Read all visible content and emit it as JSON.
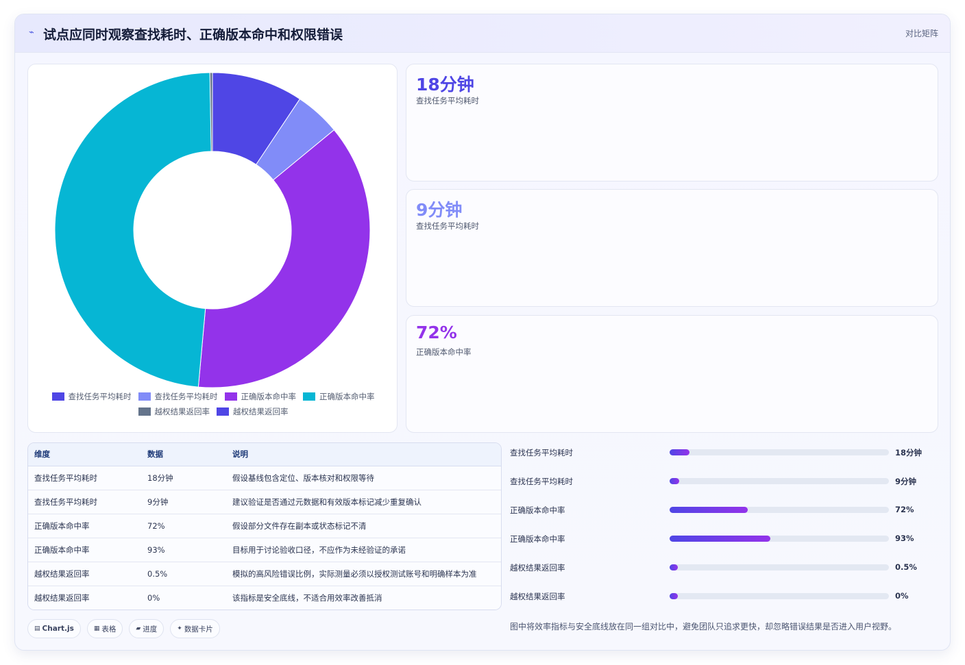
{
  "header": {
    "icon": "trend-icon",
    "title": "试点应同时观察查找耗时、正确版本命中和权限错误",
    "badge": "对比矩阵"
  },
  "colors": {
    "indigo": "#4f46e5",
    "light_indigo": "#818cf8",
    "violet": "#9333ea",
    "cyan": "#06b6d4",
    "slate": "#64748b"
  },
  "chart_data": {
    "type": "doughnut",
    "title": "",
    "legend_position": "bottom",
    "categories": [
      "查找任务平均耗时",
      "查找任务平均耗时",
      "正确版本命中率",
      "正确版本命中率",
      "越权结果返回率",
      "越权结果返回率"
    ],
    "values": [
      18,
      9,
      72,
      93,
      0.5,
      0
    ],
    "colors": [
      "#4f46e5",
      "#818cf8",
      "#9333ea",
      "#06b6d4",
      "#64748b",
      "#4f46e5"
    ]
  },
  "kpis": [
    {
      "value": "18分钟",
      "label": "查找任务平均耗时",
      "color": "#4f46e5"
    },
    {
      "value": "9分钟",
      "label": "查找任务平均耗时",
      "color": "#818cf8"
    },
    {
      "value": "72%",
      "label": "正确版本命中率",
      "color": "#9333ea"
    }
  ],
  "table": {
    "headers": [
      "维度",
      "数据",
      "说明"
    ],
    "rows": [
      [
        "查找任务平均耗时",
        "18分钟",
        "假设基线包含定位、版本核对和权限等待"
      ],
      [
        "查找任务平均耗时",
        "9分钟",
        "建议验证是否通过元数据和有效版本标记减少重复确认"
      ],
      [
        "正确版本命中率",
        "72%",
        "假设部分文件存在副本或状态标记不清"
      ],
      [
        "正确版本命中率",
        "93%",
        "目标用于讨论验收口径，不应作为未经验证的承诺"
      ],
      [
        "越权结果返回率",
        "0.5%",
        "模拟的高风险错误比例，实际测量必须以授权测试账号和明确样本为准"
      ],
      [
        "越权结果返回率",
        "0%",
        "该指标是安全底线，不适合用效率改善抵消"
      ]
    ]
  },
  "progress": [
    {
      "label": "查找任务平均耗时",
      "value": "18分钟",
      "fraction": 0.09
    },
    {
      "label": "查找任务平均耗时",
      "value": "9分钟",
      "fraction": 0.045
    },
    {
      "label": "正确版本命中率",
      "value": "72%",
      "fraction": 0.355
    },
    {
      "label": "正确版本命中率",
      "value": "93%",
      "fraction": 0.458
    },
    {
      "label": "越权结果返回率",
      "value": "0.5%",
      "fraction": 0.036
    },
    {
      "label": "越权结果返回率",
      "value": "0%",
      "fraction": 0.036
    }
  ],
  "chips": [
    {
      "icon": "chart-icon",
      "glyph": "▤",
      "label": "Chart.js"
    },
    {
      "icon": "table-icon",
      "glyph": "▦",
      "label": "表格"
    },
    {
      "icon": "progress-icon",
      "glyph": "▰",
      "label": "进度"
    },
    {
      "icon": "card-icon",
      "glyph": "✦",
      "label": "数据卡片"
    }
  ],
  "note": "图中将效率指标与安全底线放在同一组对比中，避免团队只追求更快，却忽略错误结果是否进入用户视野。"
}
